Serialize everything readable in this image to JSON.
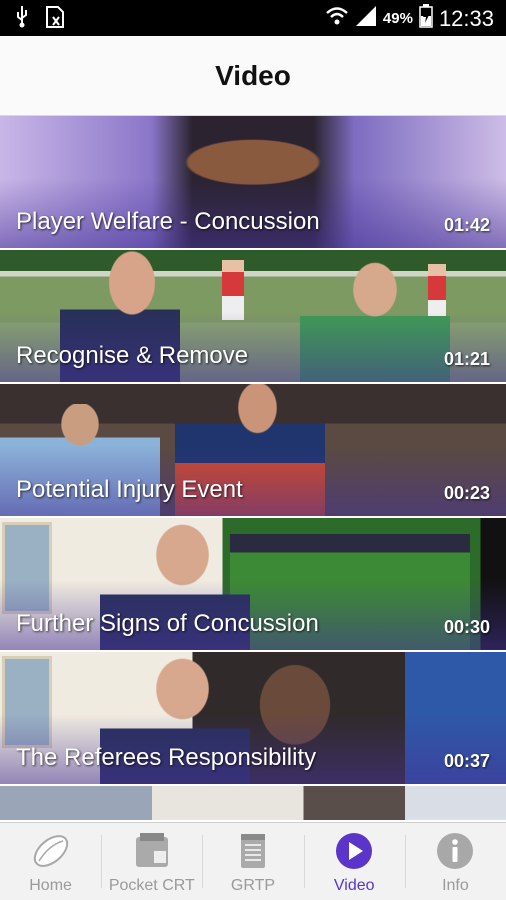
{
  "status_bar": {
    "battery_percent": "49%",
    "time": "12:33",
    "icons": [
      "usb-icon",
      "sim-icon",
      "wifi-icon",
      "signal-icon",
      "battery-icon"
    ]
  },
  "header": {
    "title": "Video"
  },
  "videos": [
    {
      "title": "Player Welfare - Concussion",
      "duration": "01:42"
    },
    {
      "title": "Recognise & Remove",
      "duration": "01:21"
    },
    {
      "title": "Potential Injury Event",
      "duration": "00:23"
    },
    {
      "title": "Further Signs of Concussion",
      "duration": "00:30"
    },
    {
      "title": "The Referees Responsibility",
      "duration": "00:37"
    }
  ],
  "nav": {
    "active": "Video",
    "accent_color": "#5b35c9",
    "tabs": [
      {
        "label": "Home",
        "icon": "rugby-ball-icon"
      },
      {
        "label": "Pocket CRT",
        "icon": "pocket-card-icon"
      },
      {
        "label": "GRTP",
        "icon": "document-icon"
      },
      {
        "label": "Video",
        "icon": "play-icon"
      },
      {
        "label": "Info",
        "icon": "info-icon"
      }
    ]
  }
}
